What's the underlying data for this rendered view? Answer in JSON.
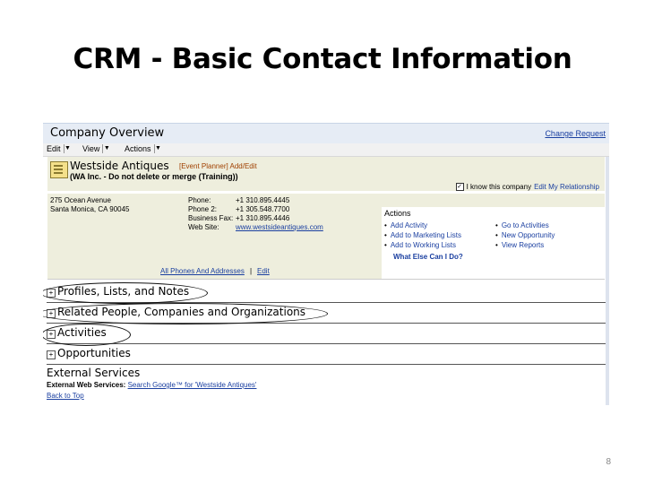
{
  "slide": {
    "title": "CRM - Basic Contact Information",
    "page_number": "8"
  },
  "header": {
    "title": "Company Overview",
    "change_request": "Change Request"
  },
  "menu": [
    {
      "label": "Edit"
    },
    {
      "label": "View"
    },
    {
      "label": "Actions"
    }
  ],
  "company": {
    "name": "Westside Antiques",
    "event_planner": "[Event Planner] Add/Edit",
    "subtitle": "(WA Inc. - Do not delete or merge (Training))",
    "know_label": "I know this company",
    "edit_relationship": "Edit My Relationship",
    "address": [
      "275 Ocean Avenue",
      "Santa Monica, CA 90045"
    ],
    "phone_labels": [
      "Phone:",
      "Phone 2:",
      "Business Fax:",
      "Web Site:"
    ],
    "phone_values": [
      "+1 310.895.4445",
      "+1 305.548.7700",
      "+1 310.895.4446",
      "www.westsideantiques.com"
    ],
    "all_phones": "All Phones And Addresses",
    "all_phones_sep": "|",
    "all_phones_edit": "Edit"
  },
  "actions": {
    "title": "Actions",
    "left": [
      "Add Activity",
      "Add to Marketing Lists",
      "Add to Working Lists"
    ],
    "right": [
      "Go to Activities",
      "New Opportunity",
      "View Reports"
    ],
    "what_else": "What Else Can I Do?"
  },
  "sections": [
    {
      "label": "Profiles, Lists, and Notes",
      "circled": true
    },
    {
      "label": "Related People, Companies and Organizations",
      "circled": true
    },
    {
      "label": "Activities",
      "circled": true
    },
    {
      "label": "Opportunities",
      "circled": false
    }
  ],
  "external": {
    "title": "External Services",
    "line_label": "External Web Services:",
    "line_link": "Search Google™ for 'Westside Antiques'",
    "back_to_top": "Back to Top"
  },
  "icons": {
    "company": "company-card-icon",
    "expand": "expand-plus-icon",
    "dropdown": "dropdown-arrow-icon",
    "checkbox": "checkbox-checked-icon"
  },
  "colors": {
    "link": "#1a3fa0",
    "header_bg": "#e6ecf5",
    "panel_bg": "#eeeedd"
  }
}
